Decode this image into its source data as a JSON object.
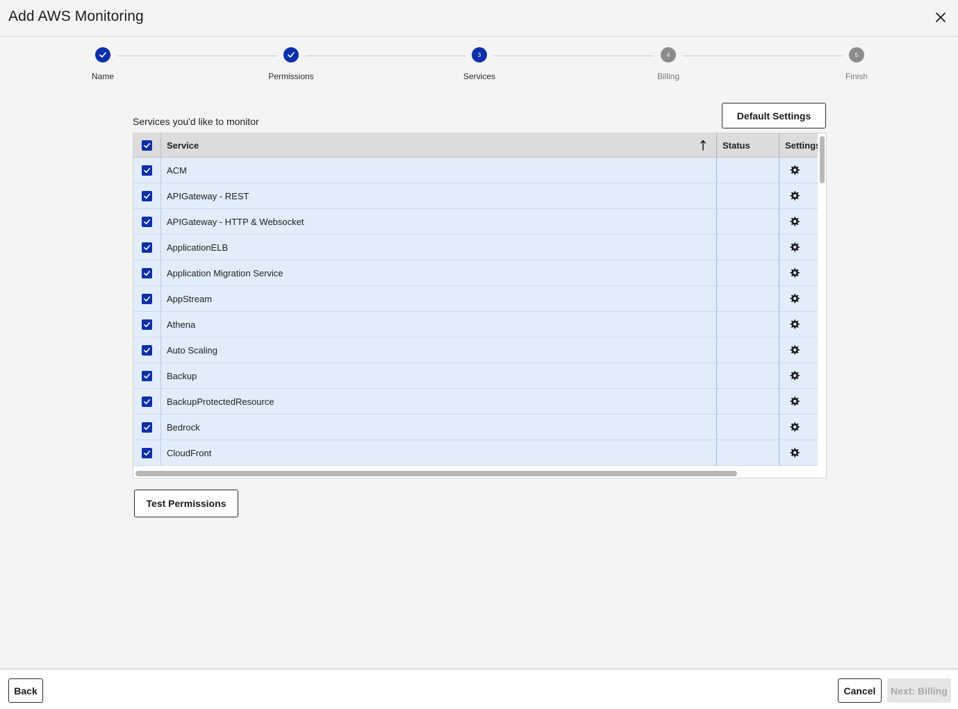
{
  "dialog": {
    "title": "Add AWS Monitoring"
  },
  "stepper": {
    "steps": [
      {
        "label": "Name",
        "number": "1",
        "state": "done"
      },
      {
        "label": "Permissions",
        "number": "2",
        "state": "done"
      },
      {
        "label": "Services",
        "number": "3",
        "state": "active"
      },
      {
        "label": "Billing",
        "number": "4",
        "state": "pending"
      },
      {
        "label": "Finish",
        "number": "5",
        "state": "pending"
      }
    ]
  },
  "services": {
    "heading": "Services you'd like to monitor",
    "default_settings_label": "Default Settings",
    "test_permissions_label": "Test Permissions",
    "columns": {
      "service": "Service",
      "status": "Status",
      "settings": "Settings"
    },
    "rows": [
      {
        "name": "ACM",
        "status": "",
        "checked": true
      },
      {
        "name": "APIGateway - REST",
        "status": "",
        "checked": true
      },
      {
        "name": "APIGateway - HTTP & Websocket",
        "status": "",
        "checked": true
      },
      {
        "name": "ApplicationELB",
        "status": "",
        "checked": true
      },
      {
        "name": "Application Migration Service",
        "status": "",
        "checked": true
      },
      {
        "name": "AppStream",
        "status": "",
        "checked": true
      },
      {
        "name": "Athena",
        "status": "",
        "checked": true
      },
      {
        "name": "Auto Scaling",
        "status": "",
        "checked": true
      },
      {
        "name": "Backup",
        "status": "",
        "checked": true
      },
      {
        "name": "BackupProtectedResource",
        "status": "",
        "checked": true
      },
      {
        "name": "Bedrock",
        "status": "",
        "checked": true
      },
      {
        "name": "CloudFront",
        "status": "",
        "checked": true
      }
    ]
  },
  "footer": {
    "back_label": "Back",
    "cancel_label": "Cancel",
    "next_label": "Next: Billing"
  },
  "colors": {
    "accent": "#0a2fa8",
    "row_bg": "#e1edfb",
    "pending": "#8c8c8c"
  }
}
